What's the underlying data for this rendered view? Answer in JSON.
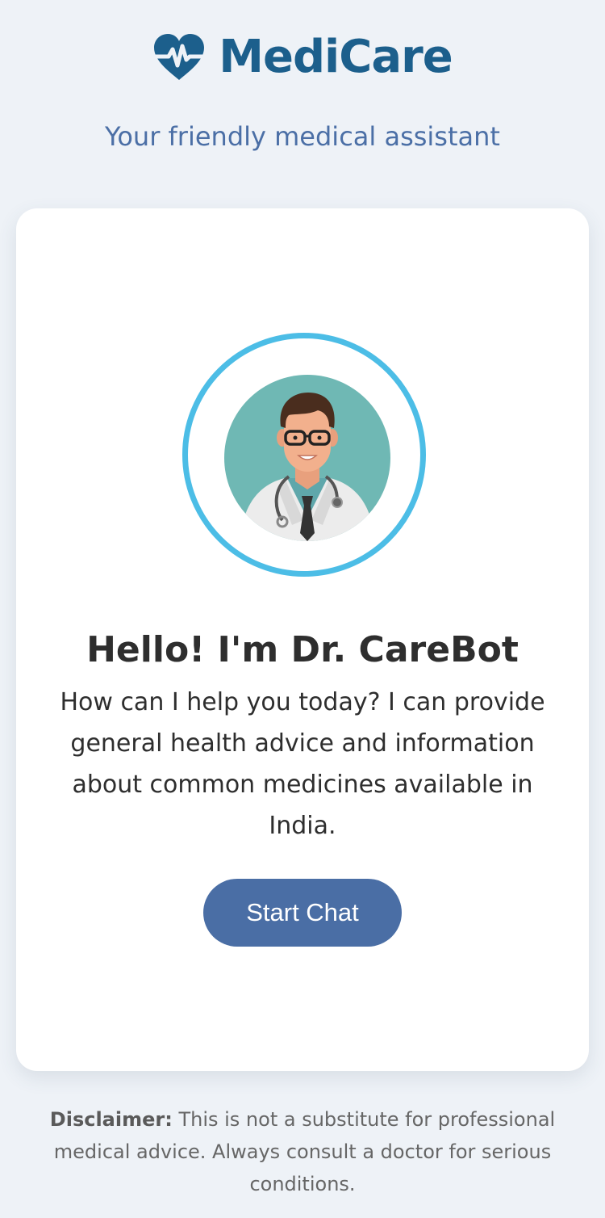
{
  "header": {
    "logo_icon": "heart-pulse-icon",
    "brand": "MediCare",
    "tagline": "Your friendly medical assistant"
  },
  "card": {
    "avatar": "doctor-avatar",
    "greeting": "Hello! I'm Dr. CareBot",
    "intro": "How can I help you today? I can provide general health advice and information about common medicines available in India.",
    "start_button_label": "Start Chat"
  },
  "footer": {
    "disclaimer_label": "Disclaimer:",
    "disclaimer_text": " This is not a substitute for professional medical advice. Always consult a doctor for serious conditions."
  },
  "colors": {
    "background": "#eef2f7",
    "brand": "#1c5f8c",
    "tagline": "#4b6fa6",
    "ring": "#4cbde6",
    "button": "#4a6ea5"
  }
}
